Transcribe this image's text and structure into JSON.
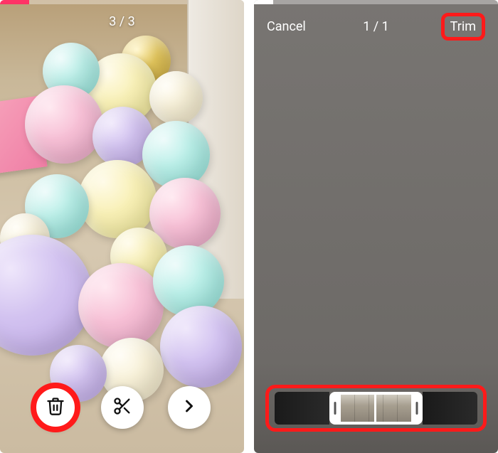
{
  "left": {
    "counter": "3 / 3",
    "progress_percent": 12,
    "buttons": {
      "delete": "delete",
      "trim": "trim",
      "next": "next"
    },
    "icons": {
      "trash": "trash-icon",
      "scissors": "scissors-icon",
      "chevron_right": "chevron-right-icon"
    }
  },
  "right": {
    "cancel": "Cancel",
    "counter": "1 / 1",
    "trim": "Trim",
    "progress_percent": 8,
    "timeline": {
      "selected_start_fraction": 0.27,
      "selected_end_fraction": 0.73,
      "playhead_fraction": 0.49,
      "thumbnail_count": 5
    }
  },
  "annotations": {
    "highlight_color": "#ff1a1a"
  }
}
